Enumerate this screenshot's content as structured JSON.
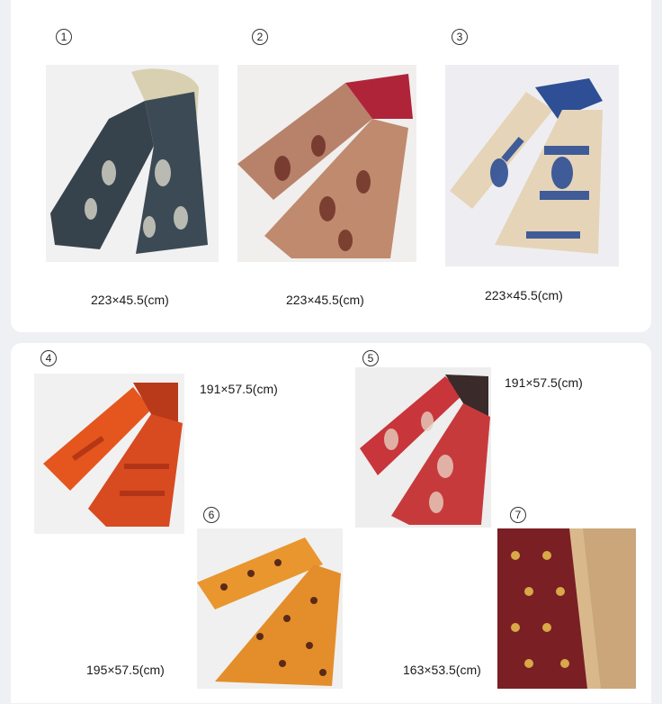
{
  "items": [
    {
      "number": "1",
      "size": "223×45.5(cm)",
      "image": "navy-scarf-image"
    },
    {
      "number": "2",
      "size": "223×45.5(cm)",
      "image": "brown-scarf-image"
    },
    {
      "number": "3",
      "size": "223×45.5(cm)",
      "image": "blue-cream-scarf-image"
    },
    {
      "number": "4",
      "size": "191×57.5(cm)",
      "image": "orange-red-scarf-image"
    },
    {
      "number": "5",
      "size": "191×57.5(cm)",
      "image": "red-scarf-image"
    },
    {
      "number": "6",
      "size": "195×57.5(cm)",
      "image": "mustard-scarf-image"
    },
    {
      "number": "7",
      "size": "163×53.5(cm)",
      "image": "maroon-stole-image"
    }
  ],
  "colors": {
    "background": "#eef0f3",
    "card": "#ffffff",
    "text": "#1a1a1a"
  }
}
